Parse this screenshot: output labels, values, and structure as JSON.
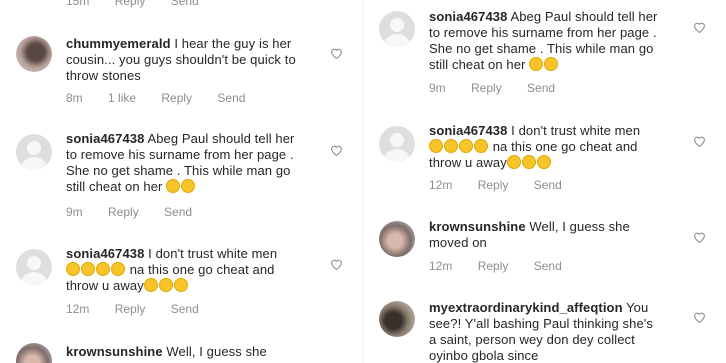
{
  "icons": {
    "like": "heart-outline-icon",
    "emoji": "laughing-emoji-icon"
  },
  "left": {
    "top_meta": {
      "time": "15m",
      "reply": "Reply",
      "send": "Send"
    },
    "comments": [
      {
        "username": "chummyemerald",
        "lines": [
          "I hear the guy is her",
          "cousin... you guys shouldn't be quick to",
          "throw stones"
        ],
        "time": "8m",
        "likes": "1 like",
        "reply": "Reply",
        "send": "Send"
      },
      {
        "username": "sonia467438",
        "lines": [
          "Abeg Paul should tell her",
          "to remove his surname from her page .",
          "She no get shame . This while man go",
          "still cheat on her"
        ],
        "emoji_count": 2,
        "time": "9m",
        "reply": "Reply",
        "send": "Send"
      },
      {
        "username": "sonia467438",
        "lines": [
          "I don't trust white men",
          "na this one go cheat and",
          "throw u away"
        ],
        "emoji_before_line2": 4,
        "emoji_after_line3": 3,
        "time": "12m",
        "reply": "Reply",
        "send": "Send"
      },
      {
        "username": "krownsunshine",
        "lines": [
          "Well, I guess she"
        ]
      }
    ]
  },
  "right": {
    "comments": [
      {
        "username": "sonia467438",
        "lines": [
          "Abeg Paul should tell her",
          "to remove his surname from her page .",
          "She no get shame . This while man go",
          "still cheat on her"
        ],
        "emoji_count": 2,
        "time": "9m",
        "reply": "Reply",
        "send": "Send"
      },
      {
        "username": "sonia467438",
        "lines": [
          "I don't trust white men",
          "na this one go cheat and",
          "throw u away"
        ],
        "emoji_before_line2": 4,
        "emoji_after_line3": 3,
        "time": "12m",
        "reply": "Reply",
        "send": "Send"
      },
      {
        "username": "krownsunshine",
        "lines": [
          "Well, I guess she",
          "moved on"
        ],
        "time": "12m",
        "reply": "Reply",
        "send": "Send"
      },
      {
        "username": "myextraordinarykind_affeqtion",
        "lines": [
          "You",
          "see?! Y'all bashing Paul thinking she's",
          "a saint, person wey don dey collect",
          "oyinbo gbola since"
        ]
      }
    ]
  }
}
